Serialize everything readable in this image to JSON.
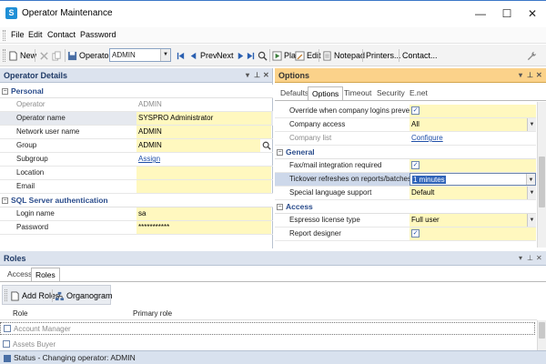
{
  "window": {
    "title": "Operator Maintenance",
    "minimize": "—",
    "maximize": "☐",
    "close": "✕"
  },
  "menu": [
    "File",
    "Edit",
    "Contact",
    "Password"
  ],
  "toolbar": {
    "new": "New",
    "operator_label": "Operator:",
    "operator_value": "ADMIN",
    "prev": "Prev",
    "next": "Next",
    "play": "Play",
    "edit": "Edit",
    "notepad": "Notepad",
    "printers": "Printers...",
    "contact": "Contact..."
  },
  "operator_details": {
    "title": "Operator Details",
    "sections": {
      "personal": "Personal",
      "sql": "SQL Server authentication"
    },
    "rows": [
      {
        "label": "Operator",
        "value": "ADMIN"
      },
      {
        "label": "Operator name",
        "value": "SYSPRO Administrator"
      },
      {
        "label": "Network user name",
        "value": "ADMIN"
      },
      {
        "label": "Group",
        "value": "ADMIN"
      },
      {
        "label": "Subgroup",
        "value": "Assign"
      },
      {
        "label": "Location",
        "value": ""
      },
      {
        "label": "Email",
        "value": ""
      },
      {
        "label": "Login name",
        "value": "sa"
      },
      {
        "label": "Password",
        "value": "***********"
      }
    ]
  },
  "options": {
    "title": "Options",
    "tabs": [
      "Defaults",
      "Options",
      "Timeout",
      "Security",
      "E.net"
    ],
    "rows_top": [
      {
        "label": "Override when company logins prevented",
        "value": "✓"
      },
      {
        "label": "Company access",
        "value": "All"
      },
      {
        "label": "Company list",
        "value": "Configure"
      }
    ],
    "sections": {
      "general": "General",
      "access": "Access"
    },
    "rows_general": [
      {
        "label": "Fax/mail integration required",
        "value": "✓"
      },
      {
        "label": "Tickover refreshes on reports/batches",
        "value": "1 minutes"
      },
      {
        "label": "Special language support",
        "value": "Default"
      }
    ],
    "rows_access": [
      {
        "label": "Espresso license type",
        "value": "Full user"
      },
      {
        "label": "Report designer",
        "value": "✓"
      }
    ]
  },
  "roles": {
    "title": "Roles",
    "tabs": [
      "Access",
      "Roles"
    ],
    "add_roles": "Add Roles",
    "organogram": "Organogram",
    "columns": [
      "Role",
      "Primary role"
    ],
    "items": [
      "Account Manager",
      "Assets Buyer"
    ]
  },
  "status": {
    "text": "Status - Changing operator: ADMIN"
  }
}
